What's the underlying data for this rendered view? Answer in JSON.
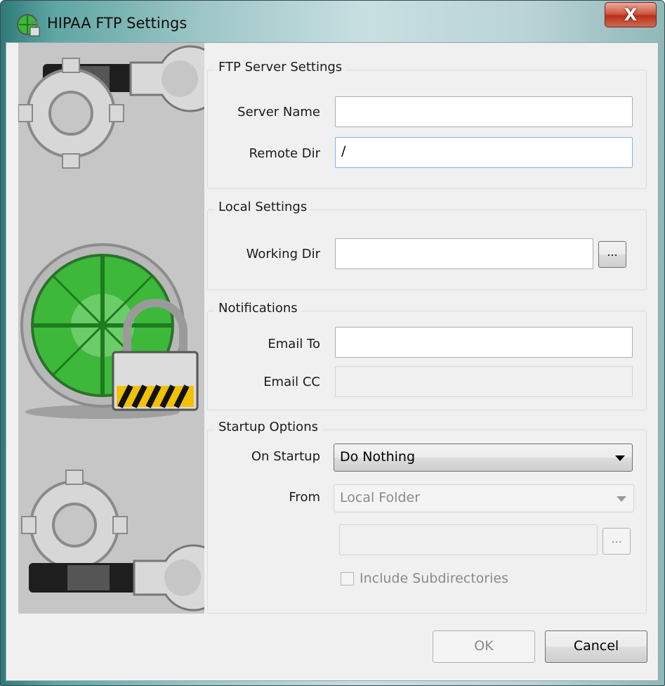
{
  "window": {
    "title": "HIPAA FTP Settings",
    "close_glyph": "X"
  },
  "ftp_server": {
    "group_title": "FTP Server Settings",
    "server_name_label": "Server Name",
    "server_name_value": "",
    "remote_dir_label": "Remote Dir",
    "remote_dir_value": "/"
  },
  "local": {
    "group_title": "Local Settings",
    "working_dir_label": "Working Dir",
    "working_dir_value": "",
    "browse_label": "..."
  },
  "notifications": {
    "group_title": "Notifications",
    "email_to_label": "Email To",
    "email_to_value": "",
    "email_cc_label": "Email CC",
    "email_cc_value": ""
  },
  "startup": {
    "group_title": "Startup Options",
    "on_startup_label": "On Startup",
    "on_startup_value": "Do Nothing",
    "from_label": "From",
    "from_value": "Local Folder",
    "path_value": "",
    "browse_label": "...",
    "include_subdirs_label": "Include Subdirectories"
  },
  "buttons": {
    "ok_label": "OK",
    "cancel_label": "Cancel"
  },
  "icons": {
    "app": "globe-lock-icon",
    "gear_wrench_top": "gear-wrench-icon",
    "globe_lock": "globe-lock-icon",
    "gear_wrench_bottom": "gear-wrench-icon"
  },
  "colors": {
    "globe_green": "#3db83a",
    "sidebar_bg": "#c6c6c6",
    "close_red": "#c9452e"
  }
}
